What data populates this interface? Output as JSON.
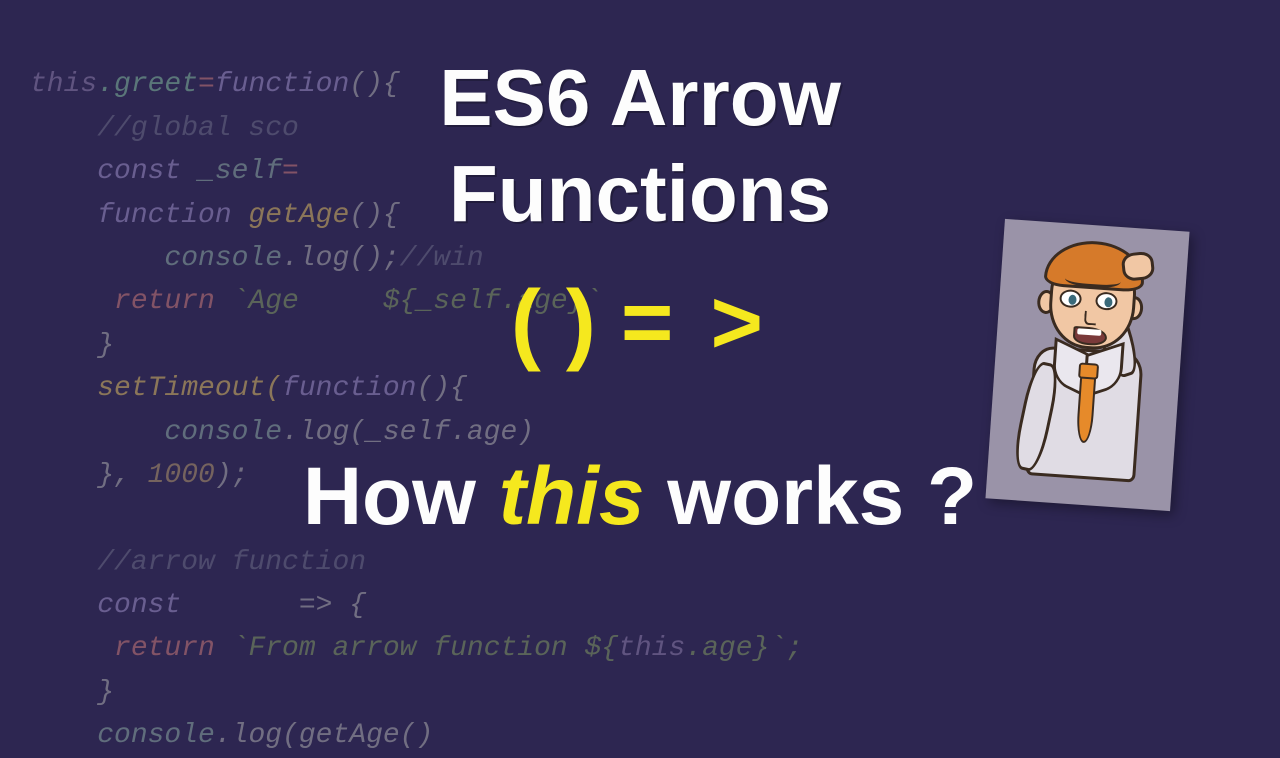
{
  "bgcode": {
    "l1_this": "this",
    "l1_greet": ".greet",
    "l1_eq": "=",
    "l1_func": "function",
    "l1_parens": "(){",
    "l2": "    //global sco",
    "l3_const": "    const ",
    "l3_self": "_self",
    "l3_eq": "=",
    "l4_func": "    function ",
    "l4_name": "getAge",
    "l4_parens": "(){",
    "l5a": "        console",
    "l5b": ".log(",
    "l5c": ");",
    "l5d": "//win",
    "l6_ret": "     return ",
    "l6_str": "`Age     ${_self.age}`",
    "l7": "    }",
    "l8a": "    setTimeout(",
    "l8b": "function",
    "l8c": "(){",
    "l9a": "        console",
    "l9b": ".log(_self.age)",
    "l10a": "    }, ",
    "l10b": "1000",
    "l10c": ");",
    "l12": "    //arrow function",
    "l13a": "    const",
    "l13b": "       ",
    "l13c": "=> {",
    "l14_ret": "     return ",
    "l14_str": "`From arrow function ${",
    "l14_this": "this",
    "l14_age": ".age}`;",
    "l15": "    }",
    "l16a": "    console",
    "l16b": ".log(getAge()"
  },
  "overlay": {
    "title1": "ES6 Arrow",
    "title2": "Functions",
    "arrow_lp": "(",
    "arrow_rp": ")",
    "arrow_eq": "=",
    "arrow_gt": ">",
    "q_how": "How ",
    "q_this": "this",
    "q_works": " works ?"
  }
}
